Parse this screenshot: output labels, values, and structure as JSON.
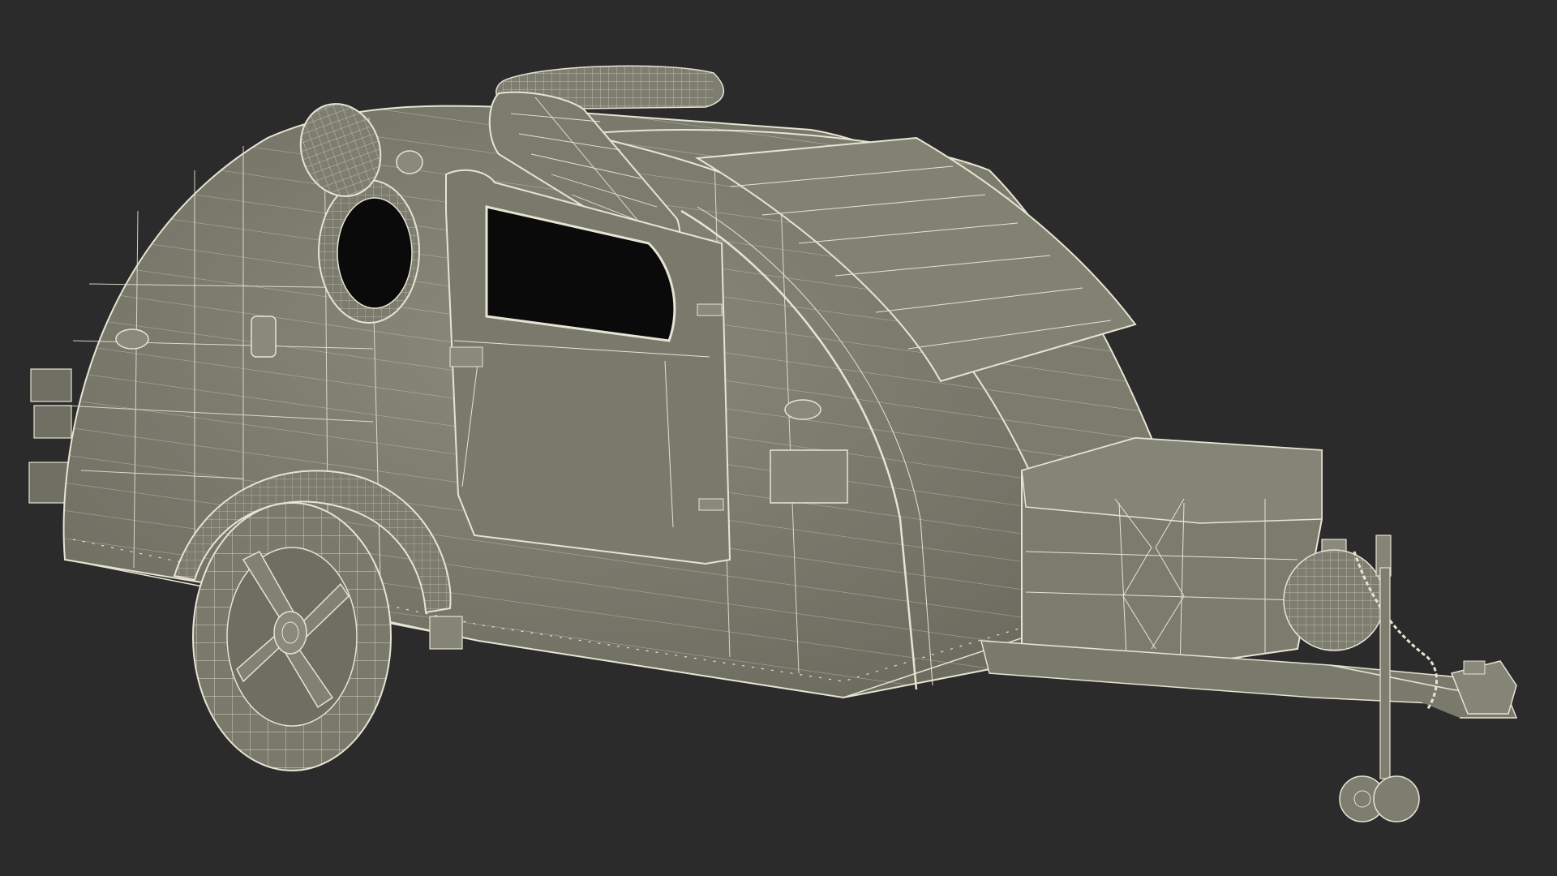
{
  "scene": {
    "subject": "teardrop-camper-trailer",
    "render_style": "wireframe-over-shaded",
    "background_color": "#2b2b2b",
    "body_color": "#7a7a6c",
    "body_shadow_color": "#5e5e52",
    "wire_color": "#e6e4d2",
    "dark_opening_color": "#0a0a0a"
  }
}
